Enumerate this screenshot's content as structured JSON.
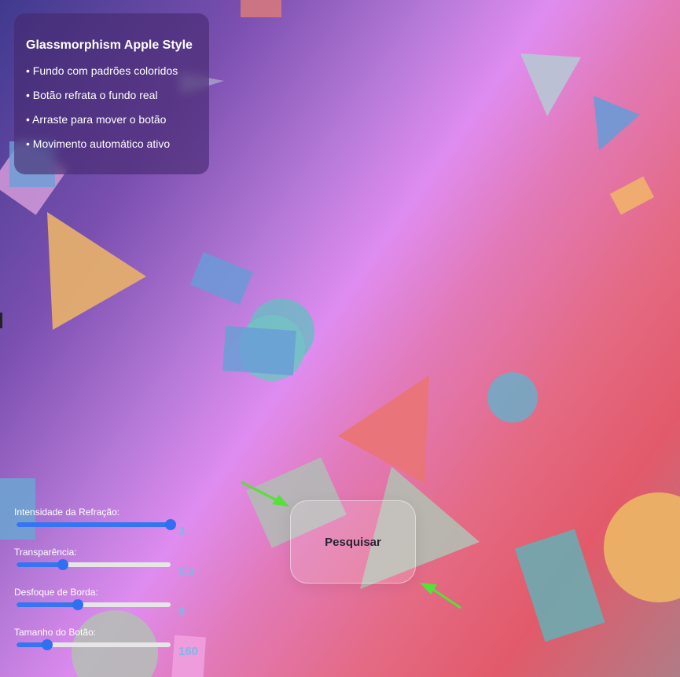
{
  "info": {
    "title": "Glassmorphism Apple Style",
    "items": [
      "Fundo com padrões coloridos",
      "Botão refrata o fundo real",
      "Arraste para mover o botão",
      "Movimento automático ativo"
    ]
  },
  "controls": [
    {
      "label": "Intensidade da Refração:",
      "value": "3",
      "fraction": 1.0
    },
    {
      "label": "Transparência:",
      "value": "0.3",
      "fraction": 0.3
    },
    {
      "label": "Desfoque de Borda:",
      "value": "8",
      "fraction": 0.4
    },
    {
      "label": "Tamanho do Botão:",
      "value": "160",
      "fraction": 0.2
    }
  ],
  "glass_button": {
    "label": "Pesquisar"
  },
  "colors": {
    "slider_accent": "#3575f0",
    "value_text": "#7fb7e6",
    "arrow": "#55e03a"
  }
}
